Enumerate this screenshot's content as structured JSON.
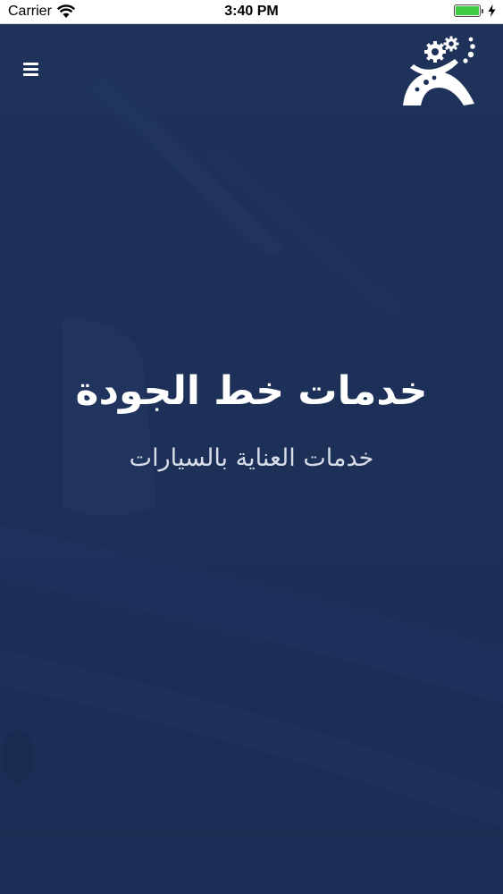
{
  "status_bar": {
    "carrier": "Carrier",
    "time": "3:40 PM",
    "battery_level": 1.0,
    "battery_color": "#3ecb41"
  },
  "nav": {
    "menu_icon": "hamburger-menu-icon",
    "logo_icon": "gears-service-logo-icon"
  },
  "hero": {
    "title": "خدمات خط الجودة",
    "subtitle": "خدمات العناية بالسيارات"
  },
  "colors": {
    "background": "#1d3058",
    "text_primary": "#ffffff",
    "text_secondary": "#d8dde8"
  }
}
